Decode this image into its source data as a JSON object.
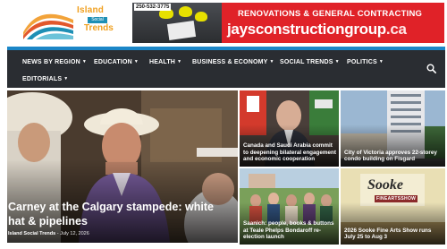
{
  "site": {
    "logo_line1": "Island",
    "logo_line2": "Social",
    "logo_line3": "Trends"
  },
  "ad": {
    "phone": "250-532-3775",
    "line1": "RENOVATIONS & GENERAL CONTRACTING",
    "line2": "jaysconstructiongroup",
    "line2_suffix": ".ca",
    "background_color": "#e02228"
  },
  "nav": {
    "accent_color": "#1b86c7",
    "background_color": "#2a2d32",
    "items": [
      {
        "label": "NEWS BY REGION"
      },
      {
        "label": "EDUCATION"
      },
      {
        "label": "HEALTH"
      },
      {
        "label": "BUSINESS & ECONOMY"
      },
      {
        "label": "SOCIAL TRENDS"
      },
      {
        "label": "POLITICS"
      },
      {
        "label": "EDITORIALS"
      }
    ],
    "search_icon": "search-icon"
  },
  "main_story": {
    "title": "Carney at the Calgary stampede: white hat & pipelines",
    "author": "Island Social Trends",
    "date": "July 12, 2026"
  },
  "tiles": [
    {
      "title": "Canada and Saudi Arabia commit to deepening bilateral engagement and economic cooperation"
    },
    {
      "title": "City of Victoria approves 22-storey condo building on Fisgard"
    },
    {
      "title": "Saanich: people, books & buttons at Teale Phelps Bondaroff re-election launch"
    },
    {
      "title": "2026 Sooke Fine Arts Show runs July 25 to Aug 3",
      "logo_text": "Sooke",
      "logo_sub": "FINEARTSSHOW"
    }
  ]
}
